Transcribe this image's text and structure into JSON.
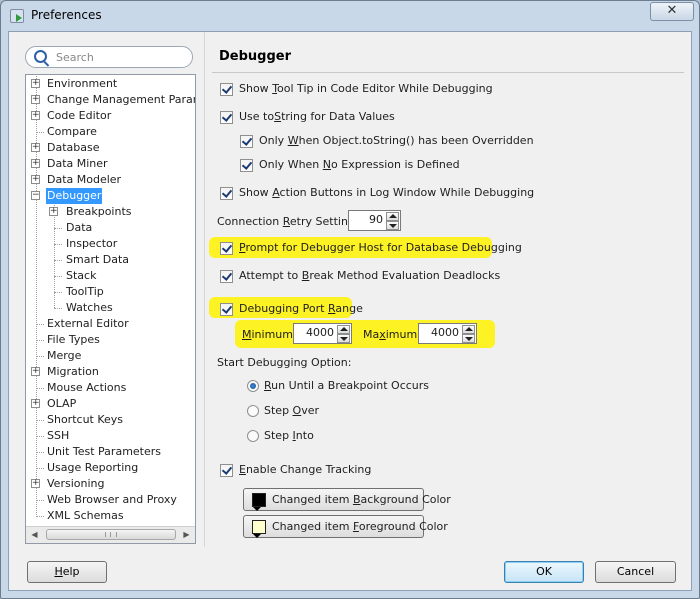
{
  "window": {
    "title": "Preferences",
    "close_glyph": "✕"
  },
  "search": {
    "placeholder": "Search",
    "value": ""
  },
  "tree": {
    "items": [
      {
        "label": "Environment",
        "expandable": true
      },
      {
        "label": "Change Management Parameters",
        "expandable": true
      },
      {
        "label": "Code Editor",
        "expandable": true
      },
      {
        "label": "Compare",
        "expandable": false
      },
      {
        "label": "Database",
        "expandable": true
      },
      {
        "label": "Data Miner",
        "expandable": true
      },
      {
        "label": "Data Modeler",
        "expandable": true
      },
      {
        "label": "Debugger",
        "expandable": true,
        "expanded": true,
        "selected": true
      },
      {
        "label": "Breakpoints",
        "expandable": true,
        "child": true
      },
      {
        "label": "Data",
        "child": true
      },
      {
        "label": "Inspector",
        "child": true
      },
      {
        "label": "Smart Data",
        "child": true
      },
      {
        "label": "Stack",
        "child": true
      },
      {
        "label": "ToolTip",
        "child": true
      },
      {
        "label": "Watches",
        "child": true
      },
      {
        "label": "External Editor",
        "expandable": false
      },
      {
        "label": "File Types",
        "expandable": false
      },
      {
        "label": "Merge",
        "expandable": false
      },
      {
        "label": "Migration",
        "expandable": true
      },
      {
        "label": "Mouse Actions",
        "expandable": false
      },
      {
        "label": "OLAP",
        "expandable": true
      },
      {
        "label": "Shortcut Keys",
        "expandable": false
      },
      {
        "label": "SSH",
        "expandable": false
      },
      {
        "label": "Unit Test Parameters",
        "expandable": false
      },
      {
        "label": "Usage Reporting",
        "expandable": false
      },
      {
        "label": "Versioning",
        "expandable": true
      },
      {
        "label": "Web Browser and Proxy",
        "expandable": false
      },
      {
        "label": "XML Schemas",
        "expandable": false
      }
    ]
  },
  "panel": {
    "title": "Debugger",
    "options": {
      "show_tooltip": {
        "label_pre": "Show ",
        "label_u": "T",
        "label_post": "ool Tip in Code Editor While Debugging",
        "checked": true
      },
      "use_tostring": {
        "label_pre": "Use to",
        "label_u": "S",
        "label_post": "tring for Data Values",
        "checked": true
      },
      "only_overridden": {
        "label_pre": "Only ",
        "label_u": "W",
        "label_post": "hen Object.toString() has been Overridden",
        "checked": true
      },
      "only_no_expression": {
        "label_pre": "Only When ",
        "label_u": "N",
        "label_post": "o Expression is Defined",
        "checked": true
      },
      "show_action_buttons": {
        "label_pre": "Show ",
        "label_u": "A",
        "label_post": "ction Buttons in Log Window While Debugging",
        "checked": true
      },
      "prompt_host": {
        "label_pre": "",
        "label_u": "P",
        "label_post": "rompt for Debugger Host for Database Debugging",
        "checked": true
      },
      "attempt_break": {
        "label_pre": "Attempt to ",
        "label_u": "B",
        "label_post": "reak Method Evaluation Deadlocks",
        "checked": true
      },
      "port_range": {
        "label_pre": "Debugging Port ",
        "label_u": "R",
        "label_post": "ange",
        "checked": true
      },
      "change_tracking": {
        "label_pre": "",
        "label_u": "E",
        "label_post": "nable Change Tracking",
        "checked": true
      }
    },
    "retry": {
      "label_pre": "Connection ",
      "label_u": "R",
      "label_post": "etry Setting:",
      "value": "90"
    },
    "port_min": {
      "label_pre": "",
      "label_u": "M",
      "label_post": "inimum:",
      "value": "4000"
    },
    "port_max": {
      "label_pre": "Ma",
      "label_u": "x",
      "label_post": "imum:",
      "value": "4000"
    },
    "start_option_label": "Start Debugging Option:",
    "start_options": {
      "run_until": {
        "label_pre": "",
        "label_u": "R",
        "label_post": "un Until a Breakpoint Occurs",
        "selected": true
      },
      "step_over": {
        "label_pre": "Step ",
        "label_u": "O",
        "label_post": "ver",
        "selected": false
      },
      "step_into": {
        "label_pre": "Step ",
        "label_u": "I",
        "label_post": "nto",
        "selected": false
      }
    },
    "color_buttons": {
      "background": {
        "label_pre": "Changed item ",
        "label_u": "B",
        "label_post": "ackground Color",
        "swatch": "#000000"
      },
      "foreground": {
        "label_pre": "Changed item ",
        "label_u": "F",
        "label_post": "oreground Color",
        "swatch": "#ffffcc"
      }
    }
  },
  "footer": {
    "help_pre": "",
    "help_u": "H",
    "help_post": "elp",
    "ok_label": "OK",
    "cancel_label": "Cancel"
  },
  "colors": {
    "highlight": "#fff200",
    "selection": "#3399ff"
  }
}
